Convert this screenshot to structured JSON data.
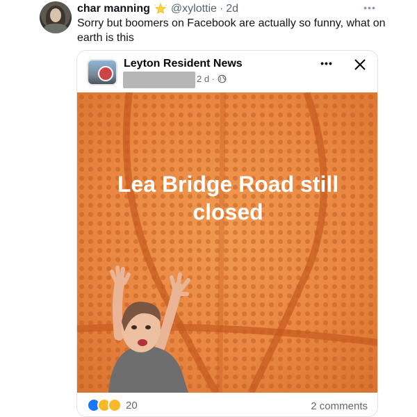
{
  "tweet": {
    "display_name": "char manning",
    "handle": "@xylottie",
    "separator": "·",
    "time": "2d",
    "text": "Sorry but boomers on Facebook are actually so funny, what on earth is this",
    "more_label": "•••"
  },
  "fb_post": {
    "page_name": "Leyton Resident News",
    "meta": "2 d ·",
    "more_label": "•••",
    "headline": "Lea Bridge Road still closed",
    "reaction_count": "20",
    "comments": "2 comments",
    "background_color": "#E98743"
  },
  "icons": {
    "avatar": "user-avatar",
    "star_emoji": "glowing-star-emoji",
    "globe": "globe-icon",
    "close": "close-icon",
    "reactions": [
      "like-icon",
      "sad-icon",
      "wow-icon"
    ]
  }
}
